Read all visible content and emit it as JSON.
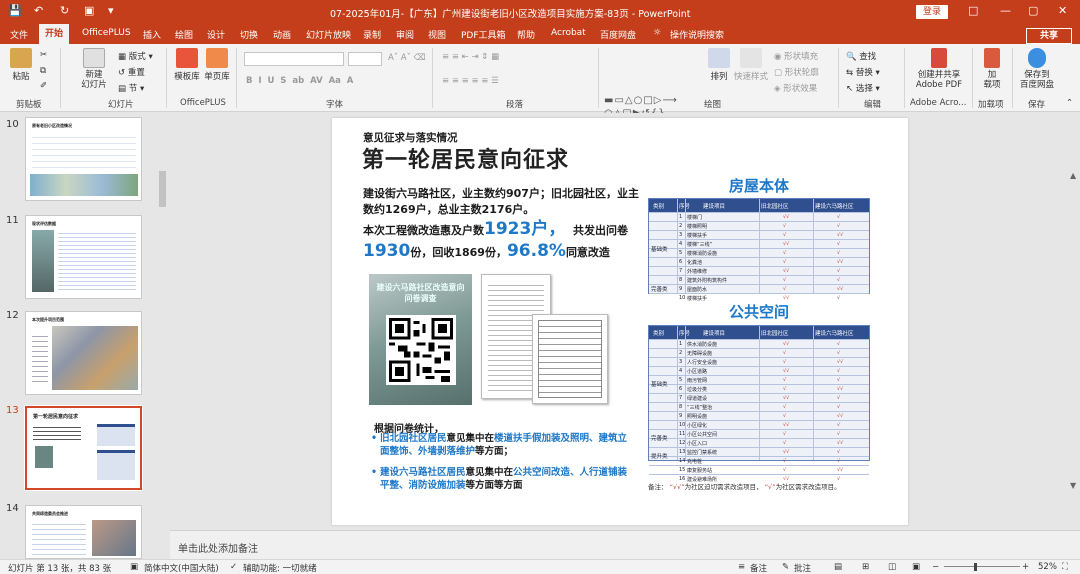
{
  "titlebar": {
    "title": "07-2025年01月-【广东】广州建设街老旧小区改造项目实施方案-83页 - PowerPoint",
    "login": "登录"
  },
  "menu": {
    "items": [
      "文件",
      "开始",
      "OfficePLUS",
      "插入",
      "绘图",
      "设计",
      "切换",
      "动画",
      "幻灯片放映",
      "录制",
      "审阅",
      "视图",
      "PDF工具箱",
      "帮助",
      "Acrobat",
      "百度网盘",
      "操作说明搜索"
    ],
    "share": "共享"
  },
  "ribbon": {
    "paste": "粘贴",
    "new_slide": "新建\n幻灯片",
    "layout": "版式",
    "reset": "重置",
    "section": "节",
    "template_lib": "模板库",
    "single_page_lib": "单页库",
    "arrange": "排列",
    "quick_styles": "快速样式",
    "shape_fill": "形状填充",
    "shape_outline": "形状轮廓",
    "shape_effects": "形状效果",
    "find": "查找",
    "replace": "替换",
    "select": "选择",
    "adobe_pdf": "创建并共享\nAdobe PDF",
    "addin": "加\n载项",
    "baidu_save": "保存到\n百度网盘",
    "groups": [
      "剪贴板",
      "幻灯片",
      "OfficePLUS",
      "字体",
      "段落",
      "绘图",
      "编辑",
      "Adobe Acro...",
      "加载项",
      "保存"
    ]
  },
  "thumbs": [
    {
      "num": "10",
      "title": "原有老旧小区改造情况"
    },
    {
      "num": "11",
      "title": "现状评估数据"
    },
    {
      "num": "12",
      "title": "本次提升项目范围"
    },
    {
      "num": "13",
      "title": "第一轮居民意向征求"
    },
    {
      "num": "14",
      "title": "共同缔造委员会推进"
    }
  ],
  "slide": {
    "subtitle": "意见征求与落实情况",
    "title": "第一轮居民意向征求",
    "para1": "建设街六马路社区，业主数约907户；旧北园社区，业主数约1269户，总业主数2176户。",
    "para2_a": "本次工程微改造惠及户数",
    "para2_b": "1923户，",
    "para2_c": "共发出问卷",
    "para3_a": "1930",
    "para3_b": "份，回收1869份，",
    "para3_c": "96.8%",
    "para3_d": "同意改造",
    "photo_text": "建设六马路社区改造意向\n问卷调查",
    "stat_title": "根据问卷统计，",
    "bullet1_a": "旧北园社区居民",
    "bullet1_b": "意见集中在",
    "bullet1_c": "楼道扶手假加装及照明、建筑立面整饰、外墙剥落维护",
    "bullet1_d": "等方面；",
    "bullet2_a": "建设六马路社区居民",
    "bullet2_b": "意见集中在",
    "bullet2_c": "公共空间改造、人行道铺装平整、消防设施加装",
    "bullet2_d": "等方面等方面",
    "sec1": "房屋本体",
    "sec2": "公共空间",
    "table_headers": [
      "类别",
      "序号",
      "建设项目",
      "旧北园社区",
      "建设六马路社区"
    ],
    "table1": {
      "cats": [
        "基础类",
        "完善类"
      ],
      "rows": [
        "楼梯门",
        "楼梯照明",
        "楼梯扶手",
        "楼梯“三线”",
        "楼梯消防设施",
        "化粪池",
        "外墙维修",
        "建筑外附构筑构件",
        "屋面防水",
        "楼梯扶手"
      ]
    },
    "table2": {
      "cats": [
        "基础类",
        "完善类",
        "提升类"
      ],
      "rows": [
        "供水消防设施",
        "无障碍设施",
        "人行安全设施",
        "小区道路",
        "雨污管网",
        "垃圾分类",
        "绿道建设",
        "“三线”整治",
        "照明设施",
        "小区绿化",
        "小区公共空间",
        "小区入口",
        "监控门禁系统",
        "充电桩",
        "康复服务站",
        "建设避难场所"
      ]
    },
    "note_a": "备注：",
    "note_b": "“√√”",
    "note_c": "为社区迫切需求改造项目，",
    "note_d": "“√”",
    "note_e": "为社区需求改造项目。"
  },
  "notes_placeholder": "单击此处添加备注",
  "status": {
    "slide_info": "幻灯片 第 13 张，共 83 张",
    "lang": "简体中文(中国大陆)",
    "access": "辅助功能: 一切就绪",
    "notes": "备注",
    "zoom": "52%"
  },
  "colors": {
    "accent": "#c43e1c",
    "slide_blue": "#1e78c8",
    "table_header": "#2f4f8f"
  }
}
